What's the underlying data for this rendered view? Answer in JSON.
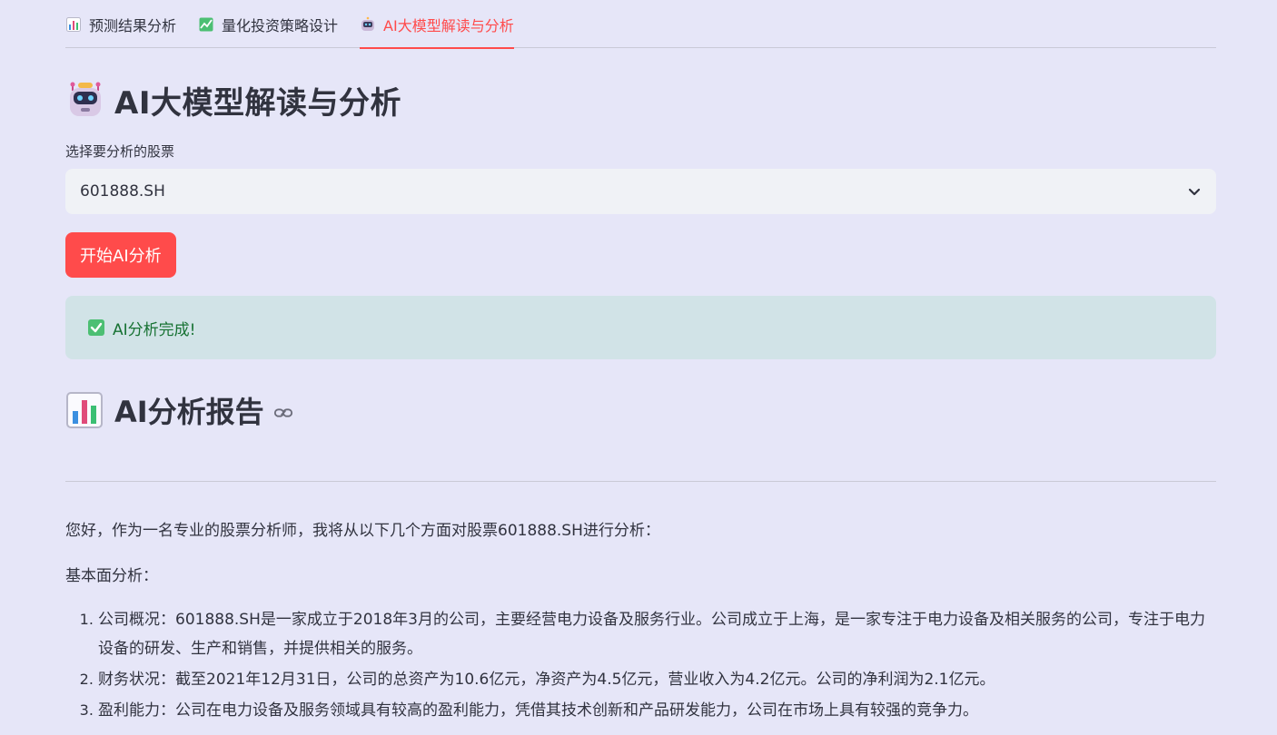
{
  "tabs": [
    {
      "label": "预测结果分析",
      "icon": "bar-chart-icon",
      "active": false
    },
    {
      "label": "量化投资策略设计",
      "icon": "trend-chart-icon",
      "active": false
    },
    {
      "label": "AI大模型解读与分析",
      "icon": "robot-icon",
      "active": true
    }
  ],
  "page": {
    "title": "AI大模型解读与分析",
    "select_label": "选择要分析的股票",
    "select_value": "601888.SH",
    "button_label": "开始AI分析",
    "success_message": "AI分析完成!",
    "report_title": "AI分析报告"
  },
  "report": {
    "intro": "您好，作为一名专业的股票分析师，我将从以下几个方面对股票601888.SH进行分析：",
    "section": "基本面分析：",
    "items": [
      "公司概况：601888.SH是一家成立于2018年3月的公司，主要经营电力设备及服务行业。公司成立于上海，是一家专注于电力设备及相关服务的公司，专注于电力设备的研发、生产和销售，并提供相关的服务。",
      "财务状况：截至2021年12月31日，公司的总资产为10.6亿元，净资产为4.5亿元，营业收入为4.2亿元。公司的净利润为2.1亿元。",
      "盈利能力：公司在电力设备及服务领域具有较高的盈利能力，凭借其技术创新和产品研发能力，公司在市场上具有较强的竞争力。"
    ]
  },
  "colors": {
    "background": "#e6e6f8",
    "accent": "#ff4b4b",
    "success_bg": "#d1e3e7",
    "success_text": "#177233"
  }
}
